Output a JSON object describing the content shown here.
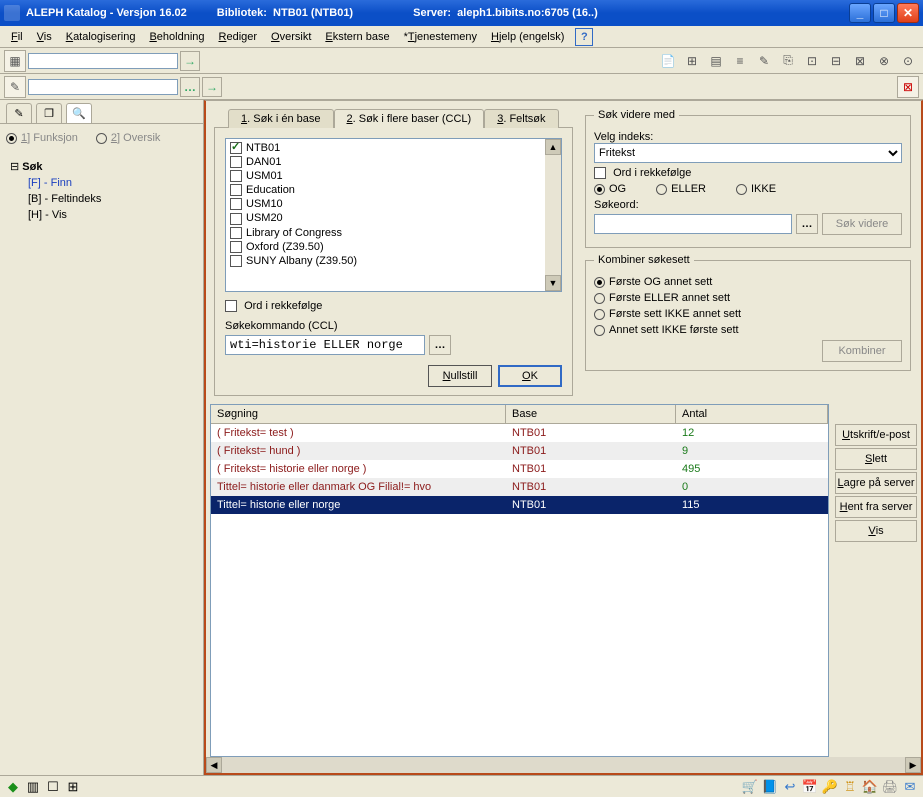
{
  "title": {
    "app": "ALEPH Katalog - Versjon 16.02",
    "lib_label": "Bibliotek:",
    "lib_value": "NTB01 (NTB01)",
    "server_label": "Server:",
    "server_value": "aleph1.bibits.no:6705 (16..)"
  },
  "menu": [
    "Fil",
    "Vis",
    "Katalogisering",
    "Beholdning",
    "Rediger",
    "Oversikt",
    "Ekstern base",
    "*Tjenestemeny",
    "Hjelp (engelsk)"
  ],
  "left": {
    "subtabs": [
      {
        "key": "1",
        "label": "Funksjon",
        "selected": true,
        "dim": true
      },
      {
        "key": "2",
        "label": "Oversik",
        "selected": false,
        "dim": true
      }
    ],
    "tree_root": "Søk",
    "tree_children": [
      {
        "label": "[F] - Finn",
        "link": true
      },
      {
        "label": "[B] - Feltindeks",
        "link": false
      },
      {
        "label": "[H] - Vis",
        "link": false
      }
    ]
  },
  "tabs": [
    {
      "label": "1. Søk i én base",
      "active": false,
      "u": "1"
    },
    {
      "label": "2. Søk i flere baser (CCL)",
      "active": true,
      "u": "2"
    },
    {
      "label": "3. Feltsøk",
      "active": false,
      "u": "3"
    }
  ],
  "databases": [
    {
      "name": "NTB01",
      "checked": true
    },
    {
      "name": "DAN01",
      "checked": false
    },
    {
      "name": "USM01",
      "checked": false
    },
    {
      "name": "Education",
      "checked": false
    },
    {
      "name": "USM10",
      "checked": false
    },
    {
      "name": "USM20",
      "checked": false
    },
    {
      "name": "Library of Congress",
      "checked": false
    },
    {
      "name": "Oxford (Z39.50)",
      "checked": false
    },
    {
      "name": "SUNY Albany (Z39.50)",
      "checked": false
    }
  ],
  "ord_label": "Ord i rekkefølge",
  "ccl_label": "Søkekommando (CCL)",
  "ccl_value": "wti=historie ELLER norge",
  "btn_null": "Nullstill",
  "btn_ok": "OK",
  "right_panel": {
    "legend1": "Søk videre med",
    "idx_label": "Velg indeks:",
    "idx_value": "Fritekst",
    "ord_label": "Ord i rekkefølge",
    "bool": {
      "og": "OG",
      "eller": "ELLER",
      "ikke": "IKKE"
    },
    "term_label": "Søkeord:",
    "btn_search": "Søk videre",
    "legend2": "Kombiner søkesett",
    "combine": [
      "Første OG annet sett",
      "Første ELLER annet sett",
      "Første sett IKKE annet sett",
      "Annet sett IKKE første sett"
    ],
    "btn_combine": "Kombiner"
  },
  "results": {
    "headers": [
      "Søgning",
      "Base",
      "Antal"
    ],
    "rows": [
      {
        "q": "( Fritekst= test )",
        "base": "NTB01",
        "n": "12",
        "alt": false
      },
      {
        "q": "( Fritekst= hund )",
        "base": "NTB01",
        "n": "9",
        "alt": true
      },
      {
        "q": "( Fritekst= historie eller norge )",
        "base": "NTB01",
        "n": "495",
        "alt": false
      },
      {
        "q": "Tittel= historie eller danmark OG Filial!= hvo",
        "base": "NTB01",
        "n": "0",
        "alt": true
      },
      {
        "q": "Tittel= historie eller norge",
        "base": "NTB01",
        "n": "115",
        "sel": true
      }
    ],
    "buttons": [
      "Utskrift/e-post",
      "Slett",
      "Lagre på server",
      "Hent fra server",
      "Vis"
    ]
  }
}
